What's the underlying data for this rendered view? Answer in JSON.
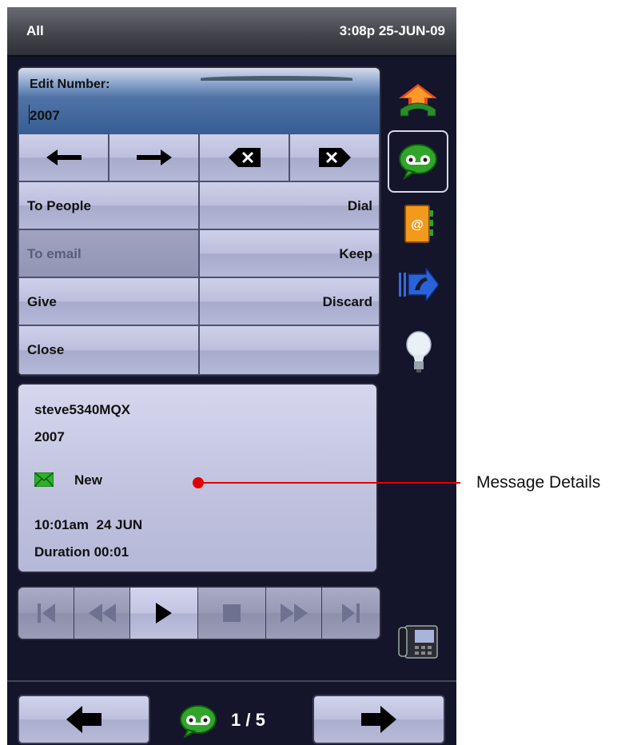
{
  "status_bar": {
    "filter": "All",
    "datetime": "3:08p 25-JUN-09"
  },
  "edit_number": {
    "label": "Edit Number:",
    "value": "2007"
  },
  "edit_keys": {
    "left_icon": "arrow-left-icon",
    "right_icon": "arrow-right-icon",
    "backspace_icon": "backspace-icon",
    "delete_icon": "delete-icon"
  },
  "actions": {
    "to_people": "To People",
    "dial": "Dial",
    "to_email": "To email",
    "keep": "Keep",
    "give": "Give",
    "discard": "Discard",
    "close": "Close",
    "blank": ""
  },
  "message": {
    "sender": "steve5340MQX",
    "number": "2007",
    "status": "New",
    "time": "10:01am  24 JUN",
    "duration": "Duration 00:01"
  },
  "playback": [
    "skip-to-start-icon",
    "rewind-icon",
    "play-icon",
    "stop-icon",
    "fast-forward-icon",
    "skip-to-end-icon"
  ],
  "sidebar": [
    "call-transfer-icon",
    "voicemail-icon",
    "address-book-icon",
    "forward-call-icon",
    "lightbulb-icon",
    "desk-phone-icon"
  ],
  "pager": {
    "counter": "1 / 5"
  },
  "callout": {
    "label": "Message Details",
    "color": "#e00000"
  },
  "colors": {
    "accent": "#bcbedd",
    "background": "#14142a",
    "voicemail_green": "#2e9a1e"
  }
}
